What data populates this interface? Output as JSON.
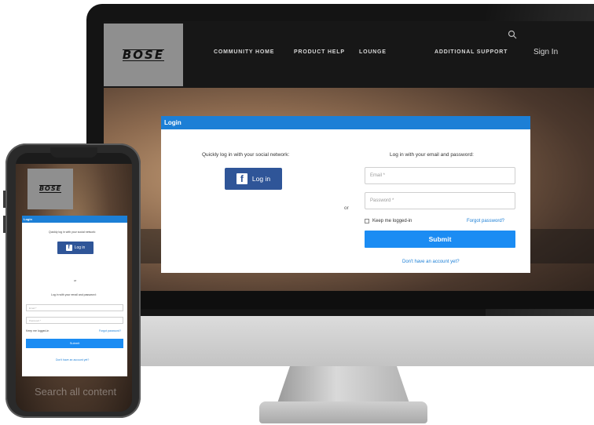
{
  "brand": {
    "logo_text": "BOSE"
  },
  "nav": {
    "items": [
      "COMMUNITY HOME",
      "PRODUCT HELP",
      "LOUNGE",
      "ADDITIONAL SUPPORT"
    ],
    "sign_in": "Sign In"
  },
  "login": {
    "title": "Login",
    "social_prompt": "Quickly log in with your social network:",
    "facebook_icon": "f",
    "facebook_label": "Log in",
    "or": "or",
    "email_prompt": "Log in with your email and password:",
    "email_placeholder": "Email *",
    "password_placeholder": "Password *",
    "keep_logged_in": "Keep me logged-in",
    "forgot_password": "Forgot password?",
    "submit": "Submit",
    "no_account": "Don't have an account yet?"
  },
  "mobile": {
    "search_text": "Search all content"
  },
  "colors": {
    "accent_blue": "#1c7fd6",
    "submit_blue": "#1b8cf3",
    "facebook_blue": "#2f5598",
    "nav_bg": "#171717"
  }
}
